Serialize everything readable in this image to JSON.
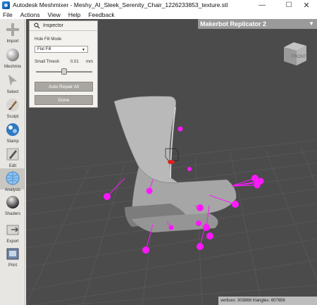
{
  "window": {
    "title": "Autodesk Meshmixer - Meshy_AI_Sleek_Serenity_Chair_1226233853_texture.stl"
  },
  "menu": [
    "File",
    "Actions",
    "View",
    "Help",
    "Feedback"
  ],
  "tools": [
    {
      "label": "Import",
      "icon": "plus-icon"
    },
    {
      "label": "Meshmix",
      "icon": "sphere-icon"
    },
    {
      "label": "Select",
      "icon": "arrow-cursor-icon"
    },
    {
      "label": "Sculpt",
      "icon": "brush-icon"
    },
    {
      "label": "Stamp",
      "icon": "stamp-icon"
    },
    {
      "label": "Edit",
      "icon": "pencil-icon"
    },
    {
      "label": "Analysis",
      "icon": "analysis-globe-icon"
    },
    {
      "label": "Shaders",
      "icon": "shader-ball-icon"
    },
    {
      "label": "Export",
      "icon": "export-icon"
    },
    {
      "label": "Print",
      "icon": "print-icon"
    }
  ],
  "inspector": {
    "title": "Inspector",
    "hole_fill_label": "Hole Fill Mode",
    "hole_fill_value": "Flat Fill",
    "small_thresh_label": "Small Thresh",
    "small_thresh_value": "0.01",
    "small_thresh_unit": "mm",
    "auto_repair_label": "Auto Repair All",
    "done_label": "Done"
  },
  "printer": {
    "name": "Makerbot Replicator 2"
  },
  "viewcube": {
    "face_label": "FRONT"
  },
  "status": {
    "text": "vertices: 303866 triangles: 607656"
  },
  "colors": {
    "viewport_bg": "#4b4b4b",
    "marker_magenta": "#ff17ff",
    "marker_red": "#e02020",
    "model_gray": "#b8b8b8"
  }
}
